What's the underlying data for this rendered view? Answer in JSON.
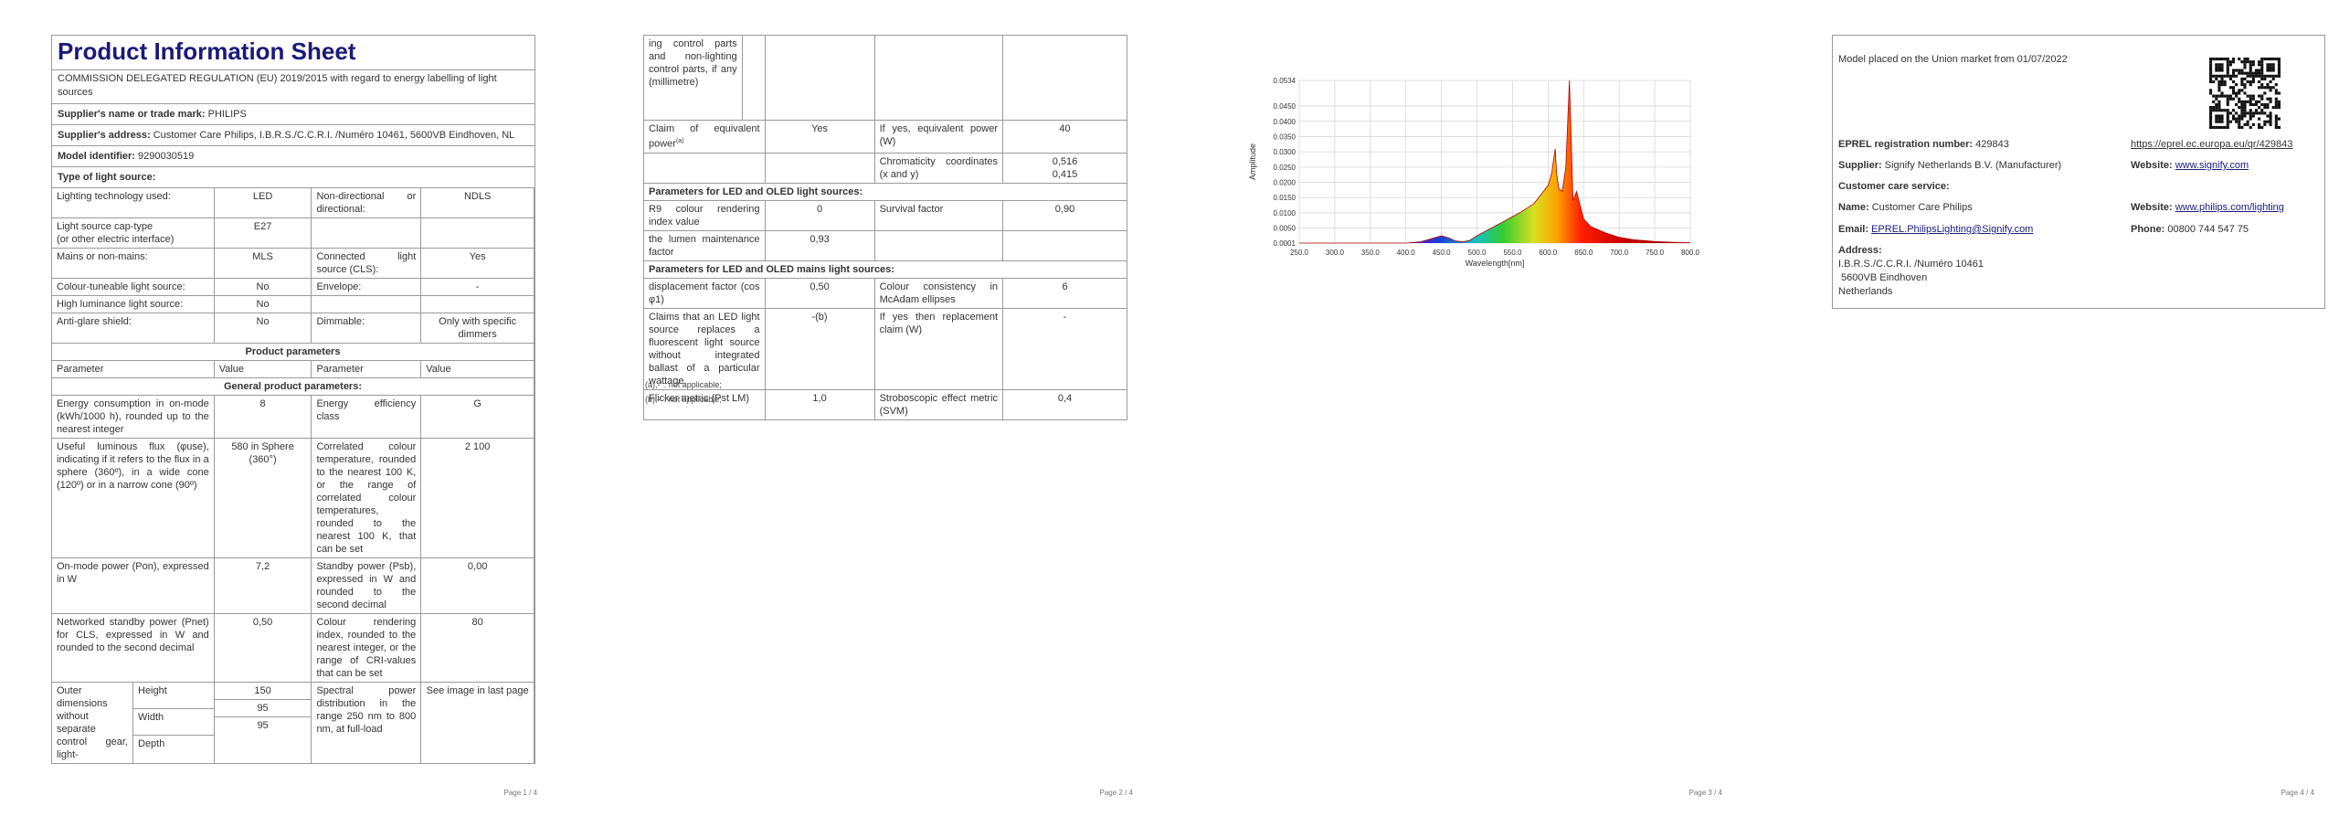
{
  "page1": {
    "title": "Product Information Sheet",
    "subtitle": "COMMISSION DELEGATED REGULATION (EU) 2019/2015 with regard to energy labelling of light sources",
    "supplier_label": "Supplier's name or trade mark:",
    "supplier_value": "PHILIPS",
    "address_label": "Supplier's address:",
    "address_value": "Customer Care Philips, I.B.R.S./C.C.R.I. /Numéro 10461, 5600VB Eindhoven, NL",
    "model_label": "Model identifier:",
    "model_value": "9290030519",
    "type_heading": "Type of light source:",
    "type_rows": [
      {
        "p1": "Lighting technology used:",
        "v1": "LED",
        "p2": "Non-directional or directional:",
        "v2": "NDLS"
      },
      {
        "p1": "Light source cap-type\n(or other electric interface)",
        "v1": "E27",
        "p2": "",
        "v2": ""
      },
      {
        "p1": "Mains or non-mains:",
        "v1": "MLS",
        "p2": "Connected light source (CLS):",
        "v2": "Yes"
      },
      {
        "p1": "Colour-tuneable light source:",
        "v1": "No",
        "p2": "Envelope:",
        "v2": "-"
      },
      {
        "p1": "High luminance light source:",
        "v1": "No",
        "p2": "",
        "v2": ""
      },
      {
        "p1": "Anti-glare shield:",
        "v1": "No",
        "p2": "Dimmable:",
        "v2": "Only with specific dimmers"
      }
    ],
    "product_params_heading": "Product parameters",
    "col_param": "Parameter",
    "col_value": "Value",
    "general_heading": "General product parameters:",
    "general_rows": [
      {
        "p1": "Energy consumption in on-mode (kWh/1000 h), rounded up to the nearest integer",
        "v1": "8",
        "p2": "Energy efficiency class",
        "v2": "G"
      },
      {
        "p1": "Useful luminous flux (φuse), indicating if it refers to the flux in a sphere (360º), in a wide cone (120º) or in a narrow cone (90º)",
        "v1": "580 in Sphere (360°)",
        "p2": "Correlated colour temperature, rounded to the nearest 100 K, or the range of correlated colour temperatures, rounded to the nearest 100 K, that can be set",
        "v2": "2 100"
      },
      {
        "p1": "On-mode power (Pon), expressed in W",
        "v1": "7,2",
        "p2": "Standby power (Psb), expressed in W and rounded to the second decimal",
        "v2": "0,00"
      },
      {
        "p1": "Networked standby power (Pnet) for CLS, expressed in W and rounded to the second decimal",
        "v1": "0,50",
        "p2": "Colour rendering index, rounded to the nearest integer, or the range of CRI-values that can be set",
        "v2": "80"
      }
    ],
    "dims_label": "Outer dimensions without separate control gear, light-",
    "dims": [
      {
        "name": "Height",
        "value": "150"
      },
      {
        "name": "Width",
        "value": "95"
      },
      {
        "name": "Depth",
        "value": "95"
      }
    ],
    "spd_label": "Spectral power distribution in the range 250 nm to 800 nm, at full-load",
    "spd_value": "See image in last page",
    "page_number": "Page 1 / 4"
  },
  "page2": {
    "cont_text": "ing control parts and non-lighting control parts, if any (millimetre)",
    "rows_a": [
      {
        "p1": "Claim of equivalent power",
        "sup1": "(a)",
        "v1": "Yes",
        "p2": "If yes, equivalent power (W)",
        "v2": "40"
      },
      {
        "p1": "",
        "sup1": "",
        "v1": "",
        "p2": "Chromaticity coordinates (x and y)",
        "v2": "0,516\n0,415"
      }
    ],
    "led_heading": "Parameters for LED and OLED light sources:",
    "rows_b": [
      {
        "p1": "R9 colour rendering index value",
        "v1": "0",
        "p2": "Survival factor",
        "v2": "0,90"
      },
      {
        "p1": "the lumen maintenance factor",
        "v1": "0,93",
        "p2": "",
        "v2": ""
      }
    ],
    "mains_heading": "Parameters for LED and OLED mains light sources:",
    "rows_c": [
      {
        "p1": "displacement factor (cos φ1)",
        "v1": "0,50",
        "p2": "Colour consistency in McAdam ellipses",
        "v2": "6"
      },
      {
        "p1": "Claims that an LED light source replaces a fluorescent light source without integrated ballast of a particular wattage.",
        "v1": "-(b)",
        "p2": "If yes then replacement claim (W)",
        "v2": "-"
      },
      {
        "p1": "Flicker metric (Pst LM)",
        "v1": "1,0",
        "p2": "Stroboscopic effect metric (SVM)",
        "v2": "0,4"
      }
    ],
    "footnote_a": "(a),-' : not applicable;",
    "footnote_b": "(b),-' : not applicable;",
    "page_number": "Page 2 / 4"
  },
  "page3": {
    "page_number": "Page 3 / 4"
  },
  "chart_data": {
    "type": "line",
    "title": "",
    "xlabel": "Wavelength[nm]",
    "ylabel": "Amplitude",
    "xlim": [
      250,
      800
    ],
    "ylim": [
      0.0001,
      0.0534
    ],
    "x_ticks": [
      "250.0",
      "300.0",
      "350.0",
      "400.0",
      "450.0",
      "500.0",
      "550.0",
      "600.0",
      "650.0",
      "700.0",
      "750.0",
      "800.0"
    ],
    "y_ticks": [
      "0.0001",
      "0.0050",
      "0.0100",
      "0.0150",
      "0.0200",
      "0.0250",
      "0.0300",
      "0.0350",
      "0.0400",
      "0.0450",
      "0.0534"
    ],
    "grid": true,
    "fill": "spectral-colors",
    "x": [
      250,
      400,
      420,
      440,
      450,
      460,
      470,
      480,
      490,
      500,
      520,
      540,
      560,
      580,
      590,
      600,
      605,
      610,
      612,
      615,
      620,
      625,
      630,
      632,
      635,
      640,
      650,
      660,
      680,
      700,
      720,
      750,
      780,
      800
    ],
    "y": [
      0.0001,
      0.0001,
      0.0005,
      0.0018,
      0.0025,
      0.0018,
      0.0008,
      0.0005,
      0.001,
      0.0025,
      0.005,
      0.0075,
      0.01,
      0.013,
      0.016,
      0.019,
      0.023,
      0.031,
      0.023,
      0.018,
      0.017,
      0.025,
      0.0534,
      0.038,
      0.014,
      0.017,
      0.008,
      0.0055,
      0.0035,
      0.002,
      0.0012,
      0.0006,
      0.0003,
      0.0002
    ]
  },
  "page4": {
    "market_text": "Model placed on the Union market from 01/07/2022",
    "eprel_label": "EPREL registration number:",
    "eprel_value": "429843",
    "eprel_link": "https://eprel.ec.europa.eu/qr/429843",
    "supplier_label": "Supplier:",
    "supplier_value": "Signify Netherlands B.V. (Manufacturer)",
    "website_label": "Website:",
    "website_value": "www.signify.com",
    "care_heading": "Customer care service:",
    "name_label": "Name:",
    "name_value": "Customer Care Philips",
    "website2_label": "Website:",
    "website2_value": "www.philips.com/lighting",
    "email_label": "Email:",
    "email_value": "EPREL.PhilipsLighting@Signify.com",
    "phone_label": "Phone:",
    "phone_value": "00800 744 547 75",
    "address_label": "Address:",
    "address_lines": [
      "I.B.R.S./C.C.R.I. /Numéro 10461",
      " 5600VB Eindhoven",
      "Netherlands"
    ],
    "page_number": "Page 4 / 4"
  }
}
